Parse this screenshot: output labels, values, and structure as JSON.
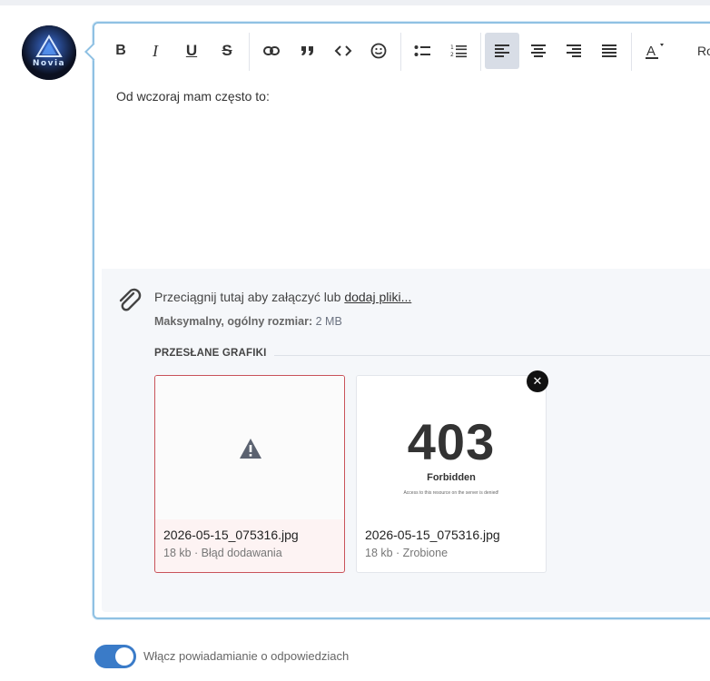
{
  "avatar": {
    "label": "Novia"
  },
  "toolbar": {
    "bold": "B",
    "italic": "I",
    "underline": "U",
    "strike": "S",
    "font_size_label": "Ro"
  },
  "editor": {
    "content": "Od wczoraj mam często to:"
  },
  "attachments": {
    "drop_text": "Przeciągnij tutaj aby załączyć lub",
    "add_link": "dodaj pliki...",
    "max_size_label": "Maksymalny, ogólny rozmiar:",
    "max_size_value": "2 MB",
    "section_title": "PRZESŁANE GRAFIKI",
    "files": [
      {
        "name": "2026-05-15_075316.jpg",
        "meta": "18 kb · Błąd dodawania",
        "status": "error"
      },
      {
        "name": "2026-05-15_075316.jpg",
        "meta": "18 kb · Zrobione",
        "status": "done",
        "preview": {
          "code": "403",
          "title": "Forbidden",
          "message": "Access to this resource on the server is denied!"
        }
      }
    ]
  },
  "notify": {
    "label": "Włącz powiadamianie o odpowiedziach",
    "enabled": true
  },
  "colors": {
    "accent": "#3a7bc8",
    "editor_border": "#8fc1e3",
    "error_border": "#c9535a"
  }
}
